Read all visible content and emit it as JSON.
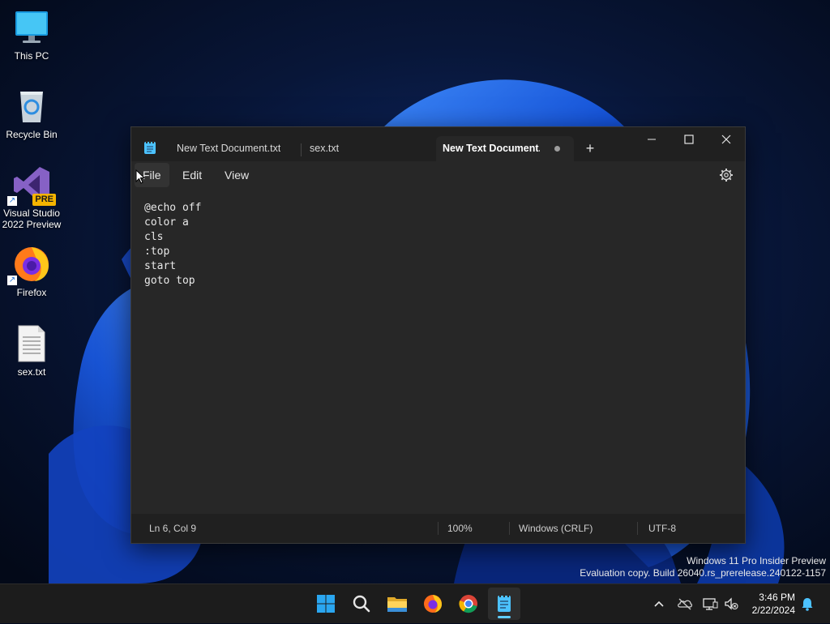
{
  "desktop": {
    "icons": [
      {
        "label": "This PC",
        "icon": "monitor-icon"
      },
      {
        "label": "Recycle Bin",
        "icon": "recycle-bin-icon"
      },
      {
        "label": "Visual Studio 2022 Preview",
        "line1": "Visual Studio",
        "line2": "2022 Preview",
        "badge": "PRE",
        "icon": "visual-studio-icon"
      },
      {
        "label": "Firefox",
        "icon": "firefox-icon"
      },
      {
        "label": "sex.txt",
        "icon": "text-file-icon"
      }
    ],
    "watermark": {
      "line1": "Windows 11 Pro Insider Preview",
      "line2": "Evaluation copy. Build 26040.rs_prerelease.240122-1157"
    }
  },
  "notepad": {
    "tabs": [
      {
        "label": "New Text Document.txt",
        "active": false
      },
      {
        "label": "sex.txt",
        "active": false
      },
      {
        "label": "New Text Document.t",
        "active": true,
        "unsaved": true
      }
    ],
    "new_tab_label": "+",
    "menu": {
      "file": "File",
      "edit": "Edit",
      "view": "View"
    },
    "content": "@echo off\ncolor a\ncls\n:top\nstart\ngoto top",
    "status": {
      "position": "Ln 6, Col 9",
      "zoom": "100%",
      "line_ending": "Windows (CRLF)",
      "encoding": "UTF-8"
    }
  },
  "taskbar": {
    "apps": [
      "start-icon",
      "search-icon",
      "file-explorer-icon",
      "firefox-icon",
      "chrome-icon",
      "notepad-icon"
    ],
    "active_app": "notepad-icon",
    "clock": {
      "time": "3:46 PM",
      "date": "2/22/2024"
    }
  },
  "colors": {
    "accent": "#60cdff",
    "window_bg": "#272727",
    "titlebar_bg": "#202020",
    "taskbar_bg": "#1c1c1c"
  }
}
